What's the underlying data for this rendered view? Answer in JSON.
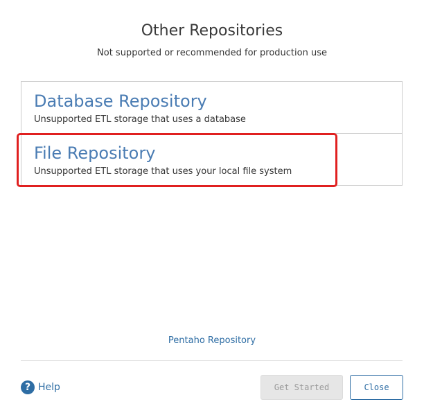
{
  "header": {
    "title": "Other Repositories",
    "subtitle": "Not supported or recommended for production use"
  },
  "repositories": [
    {
      "name": "Database Repository",
      "description": "Unsupported ETL storage that uses a database"
    },
    {
      "name": "File Repository",
      "description": "Unsupported ETL storage that uses your local file system",
      "highlighted": true
    }
  ],
  "footer": {
    "link_label": "Pentaho Repository",
    "help_label": "Help",
    "help_icon": "question-circle-icon",
    "get_started_label": "Get Started",
    "close_label": "Close"
  },
  "colors": {
    "accent": "#2e6da4",
    "repo_title": "#4a7cb3",
    "highlight": "#e02020"
  }
}
